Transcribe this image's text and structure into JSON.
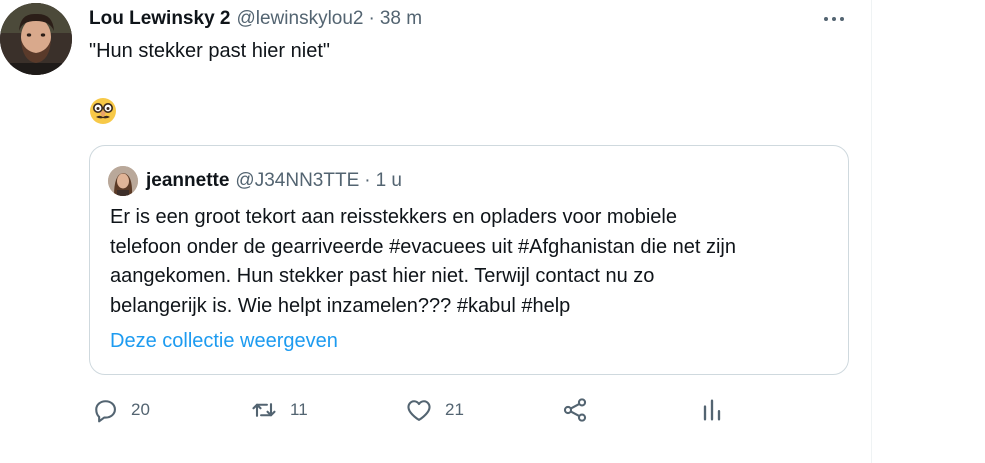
{
  "tweet": {
    "author_name": "Lou Lewinsky 2",
    "author_handle": "@lewinskylou2",
    "separator": "·",
    "time": "38 m",
    "text": "\"Hun stekker past hier niet\"",
    "emoji": "disguised-face-emoji",
    "more_icon": "more-horizontal-icon"
  },
  "quote": {
    "author_name": "jeannette",
    "author_handle": "@J34NN3TTE",
    "separator": "·",
    "time": "1 u",
    "lines": [
      "Er is een groot tekort aan reisstekkers en opladers voor mobiele",
      "telefoon onder de gearriveerde #evacuees uit #Afghanistan die net zijn",
      "aangekomen. Hun stekker past hier niet. Terwijl contact nu zo",
      "belangerijk is. Wie helpt inzamelen??? #kabul #help"
    ],
    "link_text": "Deze collectie weergeven"
  },
  "actions": {
    "reply": {
      "icon": "reply-icon",
      "count": "20"
    },
    "retweet": {
      "icon": "retweet-icon",
      "count": "11"
    },
    "like": {
      "icon": "heart-icon",
      "count": "21"
    },
    "share": {
      "icon": "share-icon"
    },
    "analytics": {
      "icon": "analytics-icon"
    }
  },
  "colors": {
    "text_primary": "#0f1419",
    "text_secondary": "#536471",
    "link": "#1d9bf0",
    "border": "#cfd9de"
  }
}
